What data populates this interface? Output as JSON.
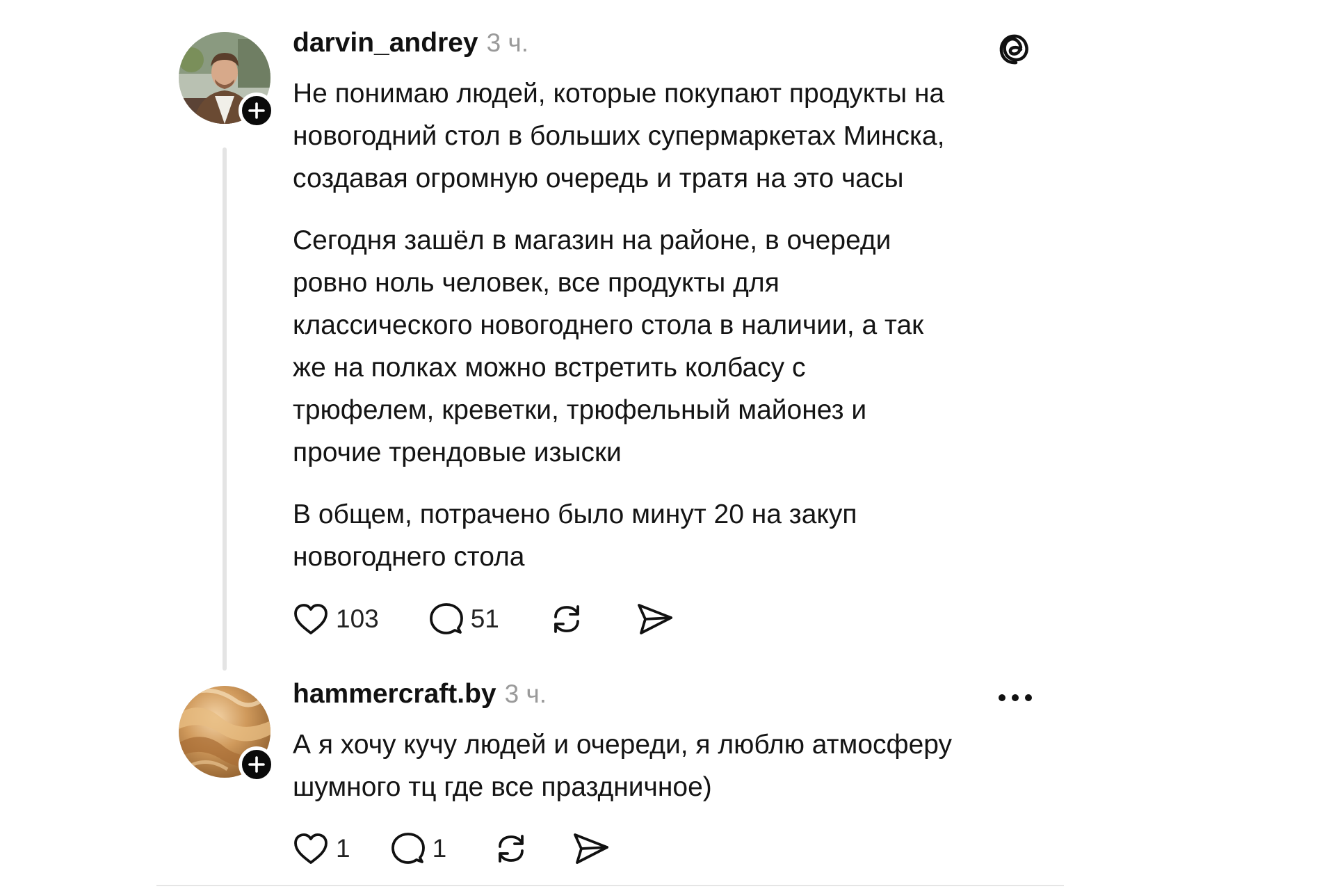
{
  "posts": [
    {
      "username": "darvin_andrey",
      "time": "3 ч.",
      "paragraphs": [
        [
          "Не понимаю людей, которые покупают продукты на",
          "новогодний стол в больших супермаркетах Минска,",
          "создавая огромную очередь и тратя на это часы"
        ],
        [
          "Сегодня зашёл в магазин на районе, в очереди",
          "ровно ноль человек, все продукты для",
          "классического новогоднего стола в наличии, а так",
          "же на полках можно встретить колбасу с",
          "трюфелем, креветки, трюфельный майонез и",
          "прочие трендовые изыски"
        ],
        [
          "В общем, потрачено было минут 20 на закуп",
          "новогоднего стола"
        ]
      ],
      "likes": "103",
      "replies": "51",
      "top_icon": "threads-logo-icon"
    },
    {
      "username": "hammercraft.by",
      "time": "3 ч.",
      "paragraphs": [
        [
          "А я хочу кучу людей и очереди, я люблю атмосферу",
          "шумного тц где все праздничное)"
        ]
      ],
      "likes": "1",
      "replies": "1",
      "top_icon": "more-options-icon"
    }
  ],
  "colors": {
    "text": "#111111",
    "muted": "#9a9a9a",
    "thread_line": "#e4e4e4",
    "badge": "#0a0a0a"
  }
}
